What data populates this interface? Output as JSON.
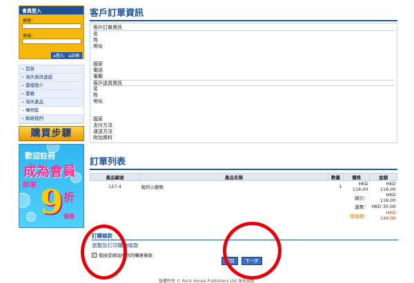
{
  "sidebar": {
    "login": {
      "title": "會員登入",
      "account_label": "帳號：",
      "password_label": "密碼：",
      "login_button": "登入",
      "register_button": "註冊"
    },
    "nav": [
      {
        "label": "首頁"
      },
      {
        "label": "海天資訊速遞"
      },
      {
        "label": "書檔簡介"
      },
      {
        "label": "書籍"
      },
      {
        "label": "海天產品"
      },
      {
        "label": "購物籃"
      },
      {
        "label": "聯絡我們"
      }
    ],
    "steps_banner": "購買步驟",
    "promo": {
      "line1": "歡迎註冊",
      "line2": "成為會員",
      "line3": "即享",
      "big_number": "9",
      "discount": "折",
      "line4": "優惠"
    }
  },
  "main": {
    "customer_section_title": "客戶訂單資訊",
    "customer_order_header": "客戶訂單資訊",
    "customer_fields": [
      "名",
      "姓",
      "地址",
      "",
      "",
      "國家",
      "電話",
      "電郵"
    ],
    "shipping_header": "客戶送貨資訊",
    "shipping_fields": [
      "名",
      "姓",
      "地址",
      "",
      "",
      "國家",
      "支付方法",
      "運送方法",
      "附加資料"
    ],
    "order_section_title": "訂單列表",
    "table": {
      "headers": [
        "產品編號",
        "產品名稱",
        "數量",
        "價格",
        "金額"
      ],
      "rows": [
        {
          "code": "127-4",
          "name": "我的小變態",
          "qty": "1",
          "price": "HKD 118.00",
          "amount": "HKD 118.00"
        }
      ],
      "summary": [
        {
          "label": "總計：",
          "value": "HKD 118.00"
        },
        {
          "label": "運費：",
          "value": "HKD 30.00"
        },
        {
          "label": "總金額：",
          "value": "HKD 148.00"
        }
      ]
    },
    "terms": {
      "heading": "訂購條款",
      "link_text": "瀏覽及打印購物條款",
      "checkbox_label": "我接受網站所列的購買條款",
      "checkbox_mark": "✓"
    },
    "buttons": {
      "back": "返回",
      "next": "下一步"
    }
  },
  "footer": "版權所有 © Rock House Publishers Ltd 海天出版",
  "colors": {
    "brand_blue": "#1e4f99",
    "highlight_red": "#e6000a",
    "login_orange": "#f6b80a"
  }
}
